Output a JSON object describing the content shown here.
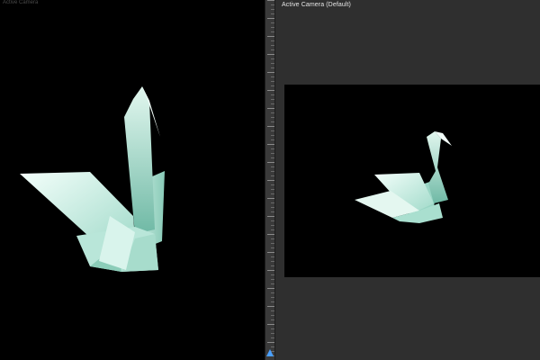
{
  "left_view": {
    "label": "Active Camera"
  },
  "right_panel": {
    "title": "Active Camera (Default)"
  },
  "icons": {
    "ruler_handle": "marker-triangle-icon"
  },
  "colors": {
    "viewport_bg": "#000000",
    "panel_bg": "#2f2f2f",
    "swan_light": "#eefaf6",
    "swan_shadow": "#7fc6b3",
    "accent": "#4aa0ff"
  }
}
